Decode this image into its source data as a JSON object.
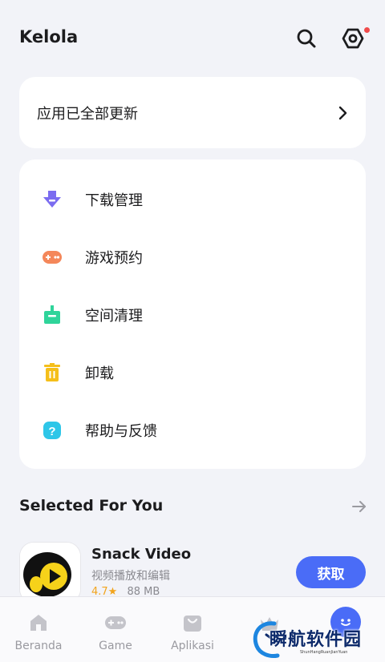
{
  "header": {
    "title": "Kelola",
    "search_icon": "search-icon",
    "settings_icon": "settings-hexagon-icon",
    "settings_badge_color": "#f04b4b"
  },
  "update_card": {
    "label": "应用已全部更新",
    "chevron_icon": "chevron-right-icon"
  },
  "menu": {
    "items": [
      {
        "label": "下载管理",
        "icon": "download-icon",
        "color": "#7b6cf0"
      },
      {
        "label": "游戏预约",
        "icon": "gamepad-icon",
        "color": "#f4875a"
      },
      {
        "label": "空间清理",
        "icon": "broom-icon",
        "color": "#2fd49a"
      },
      {
        "label": "卸载",
        "icon": "trash-icon",
        "color": "#f5bf1a"
      },
      {
        "label": "帮助与反馈",
        "icon": "help-icon",
        "color": "#2ec6e8"
      }
    ]
  },
  "section": {
    "title": "Selected For You",
    "arrow_icon": "arrow-right-icon"
  },
  "app": {
    "name": "Snack Video",
    "description": "视频播放和编辑",
    "rating": "4.7★",
    "size": "88 MB",
    "button_label": "获取",
    "accent_color": "#4a6cf7"
  },
  "bottom_nav": {
    "items": [
      {
        "label": "Beranda",
        "icon": "home-icon"
      },
      {
        "label": "Game",
        "icon": "gamepad-icon"
      },
      {
        "label": "Aplikasi",
        "icon": "bag-icon"
      },
      {
        "label": "",
        "icon": "crown-icon"
      },
      {
        "label": "",
        "icon": "manage-icon"
      }
    ]
  },
  "watermark": {
    "text": "瞬航软件园",
    "subtext": "ShunHangRuanJianYuan"
  }
}
